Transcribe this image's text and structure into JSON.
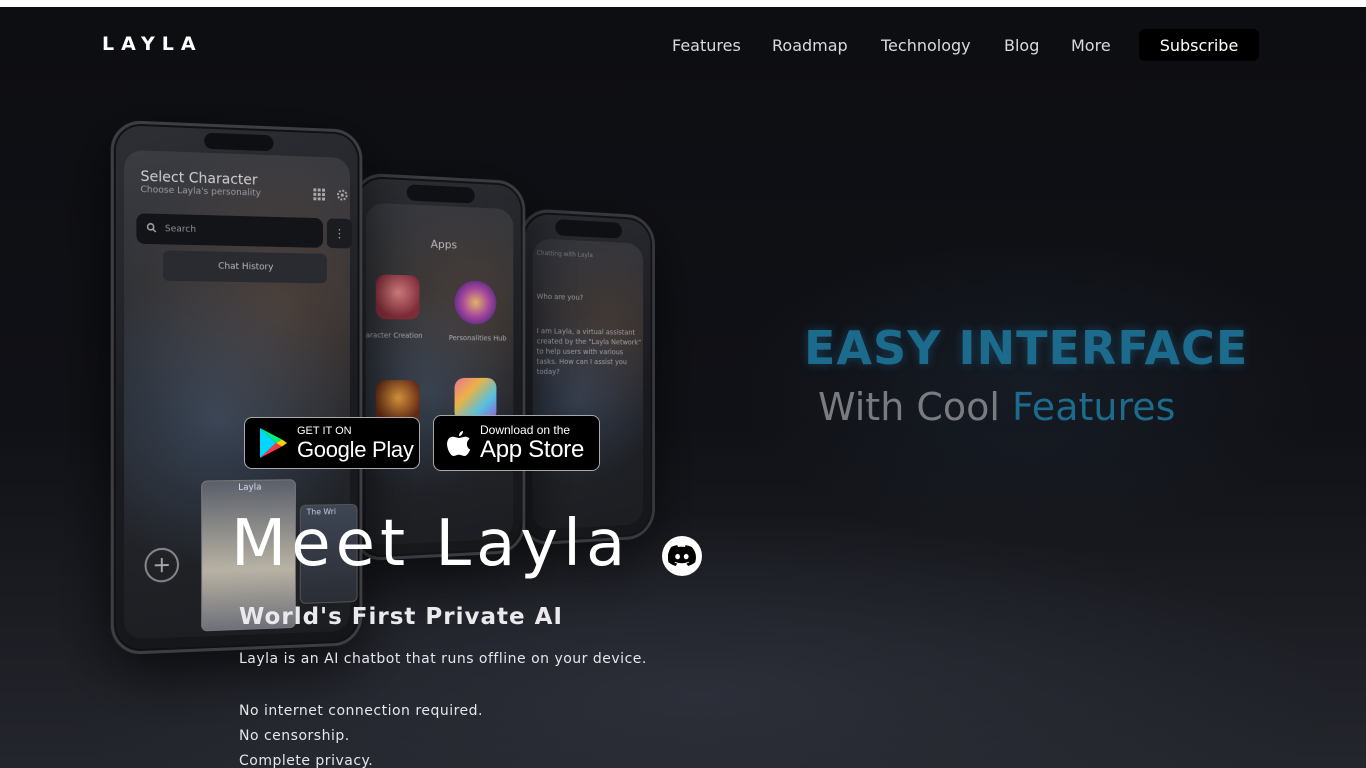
{
  "header": {
    "logo": "LAYLA",
    "nav": [
      "Features",
      "Roadmap",
      "Technology",
      "Blog",
      "More"
    ],
    "subscribe_label": "Subscribe"
  },
  "phones": {
    "main": {
      "title": "Select Character",
      "subtitle": "Choose Layla's personality",
      "search_placeholder": "Search",
      "history_label": "Chat History",
      "card1_label": "Layla",
      "card2_label": "The Wri"
    },
    "apps": {
      "title": "Apps",
      "labels": [
        "aracter Creation",
        "Personalities Hub"
      ]
    },
    "chat": {
      "header": "Chatting with Layla",
      "question": "Who are you?",
      "answer": "I am Layla, a virtual assistant created by the \"Layla Network\" to help users with various tasks. How can I assist you today?"
    }
  },
  "promo": {
    "line1": "EASY INTERFACE",
    "line2_prefix": "With Cool ",
    "line2_accent": "Features"
  },
  "badges": {
    "google": {
      "small": "GET IT ON",
      "big": "Google Play"
    },
    "apple": {
      "small": "Download on the",
      "big": "App Store"
    }
  },
  "hero": {
    "title": "Meet Layla",
    "subtitle": "World's First Private AI",
    "description": "Layla is an AI chatbot that runs offline on your device.",
    "points": [
      "No internet connection required.",
      "No censorship.",
      "Complete privacy."
    ]
  },
  "colors": {
    "accent": "#1d6b8c",
    "background": "#0b0c10",
    "subscribe_bg": "#000000"
  },
  "icons": [
    "google-play-icon",
    "apple-icon",
    "discord-icon",
    "search-icon",
    "grid-icon",
    "gear-icon",
    "plus-icon"
  ]
}
